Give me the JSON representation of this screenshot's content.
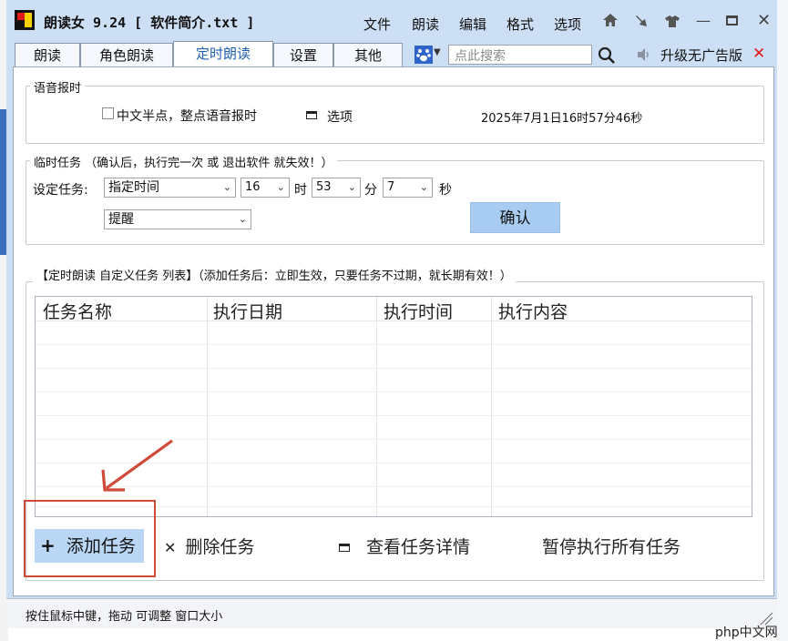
{
  "window": {
    "title": "朗读女 9.24 [ 软件简介.txt ]",
    "menu": [
      "文件",
      "朗读",
      "编辑",
      "格式",
      "选项"
    ]
  },
  "tabs": [
    "朗读",
    "角色朗读",
    "定时朗读",
    "设置",
    "其他"
  ],
  "active_tab": "定时朗读",
  "search": {
    "placeholder": "点此搜索"
  },
  "upgrade_label": "升级无广告版",
  "voice_report": {
    "title": "语音报时",
    "checkbox_label": "中文半点，整点语音报时",
    "options_label": "选项",
    "datetime": "2025年7月1日16时57分46秒"
  },
  "temp_task": {
    "title": "临时任务 （确认后，执行完一次 或 退出软件 就失效！）",
    "set_label": "设定任务:",
    "mode_value": "指定时间",
    "hour_value": "16",
    "hour_unit": "时",
    "minute_value": "53",
    "minute_unit": "分",
    "second_value": "7",
    "second_unit": "秒",
    "action_value": "提醒",
    "confirm_label": "确认"
  },
  "custom_list": {
    "title": "【定时朗读 自定义任务 列表】（添加任务后：立即生效，只要任务不过期，就长期有效！）",
    "columns": [
      "任务名称",
      "执行日期",
      "执行时间",
      "执行内容"
    ]
  },
  "actions": {
    "add": "添加任务",
    "delete": "删除任务",
    "view": "查看任务详情",
    "pause": "暂停执行所有任务"
  },
  "status": "按住鼠标中键，拖动 可调整 窗口大小",
  "watermark": "php中文网",
  "colors": {
    "accent": "#1f5fb0",
    "highlight": "#d04a3a",
    "button": "#a9cdf2"
  }
}
